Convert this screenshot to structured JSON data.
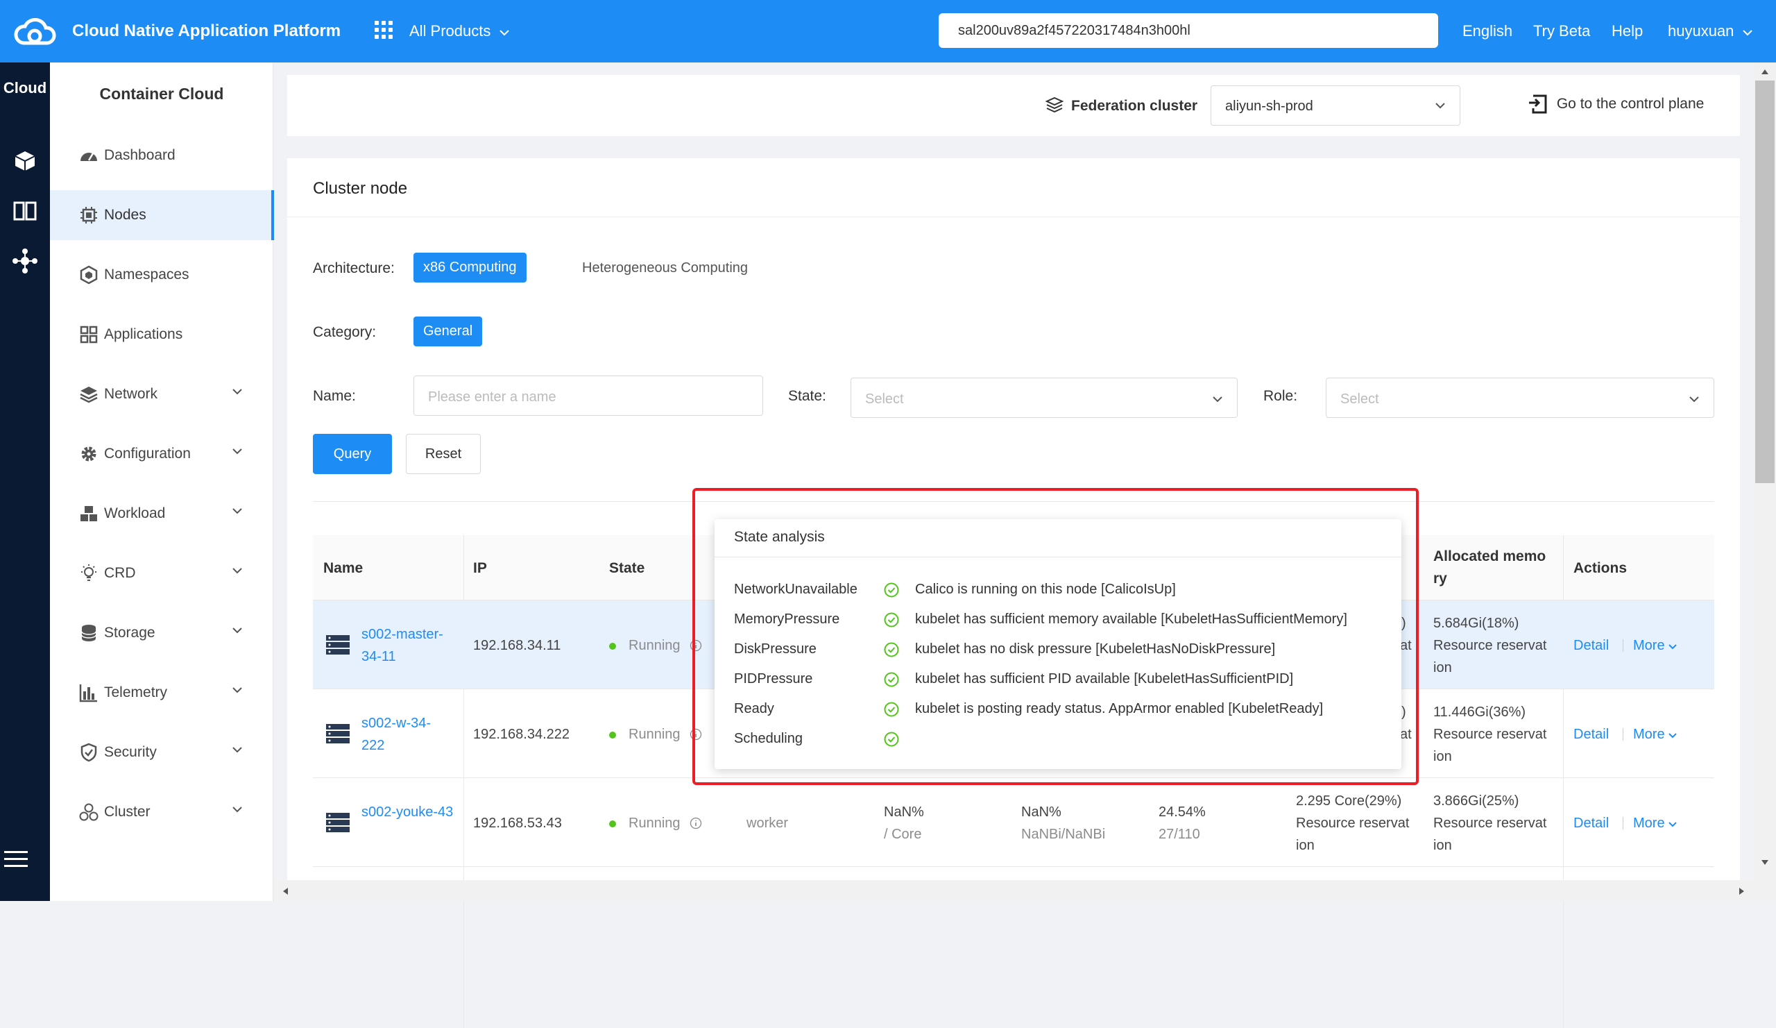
{
  "header": {
    "title": "Cloud Native Application Platform",
    "products_label": "All Products",
    "search_value": "sal200uv89a2f457220317484n3h00hl",
    "links": [
      "English",
      "Try Beta",
      "Help",
      "huyuxuan"
    ]
  },
  "rail": {
    "label": "Cloud"
  },
  "sidebar": {
    "heading": "Container Cloud",
    "items": [
      {
        "label": "Dashboard"
      },
      {
        "label": "Nodes"
      },
      {
        "label": "Namespaces"
      },
      {
        "label": "Applications"
      },
      {
        "label": "Network"
      },
      {
        "label": "Configuration"
      },
      {
        "label": "Workload"
      },
      {
        "label": "CRD"
      },
      {
        "label": "Storage"
      },
      {
        "label": "Telemetry"
      },
      {
        "label": "Security"
      },
      {
        "label": "Cluster"
      }
    ]
  },
  "fedbar": {
    "label": "Federation cluster",
    "selected": "aliyun-sh-prod",
    "control_plane": "Go to the control plane"
  },
  "page": {
    "title": "Cluster node",
    "architecture_label": "Architecture:",
    "architecture_options": [
      "x86 Computing",
      "Heterogeneous Computing"
    ],
    "category_label": "Category:",
    "category_options": [
      "General"
    ],
    "name_label": "Name:",
    "name_placeholder": "Please enter a name",
    "state_label": "State:",
    "state_placeholder": "Select",
    "role_label": "Role:",
    "role_placeholder": "Select",
    "query_label": "Query",
    "reset_label": "Reset"
  },
  "table": {
    "headers": [
      "Name",
      "IP",
      "State",
      "Allocated memo ry",
      "Actions"
    ],
    "rows": [
      {
        "name": "s002-master-34-11",
        "ip": "192.168.34.11",
        "state": "Running",
        "cpu_tail": ")",
        "cpu_tail2": "at",
        "mem": "5.684Gi(18%)",
        "mem_sub": "Resource reservat ion"
      },
      {
        "name": "s002-w-34-222",
        "ip": "192.168.34.222",
        "state": "Running",
        "cpu_tail": ")",
        "cpu_tail2": "at",
        "mem": "11.446Gi(36%)",
        "mem_sub": "Resource reservat ion"
      },
      {
        "name": "s002-youke-43",
        "ip": "192.168.53.43",
        "state": "Running",
        "role": "worker",
        "cpu_pct": "NaN%",
        "cpu_unit": "/ Core",
        "mem_pct": "NaN%",
        "mem_unit": "NaNBi/NaNBi",
        "pod_pct": "24.54%",
        "pods": "27/110",
        "alloc_cpu": "2.295 Core(29%)",
        "alloc_cpu_sub": "Resource reservat ion",
        "mem": "3.866Gi(25%)",
        "mem_sub": "Resource reservat ion"
      }
    ],
    "detail_label": "Detail",
    "more_label": "More"
  },
  "tooltip": {
    "title": "State analysis",
    "rows": [
      {
        "key": "NetworkUnavailable",
        "value": "Calico is running on this node [CalicoIsUp]"
      },
      {
        "key": "MemoryPressure",
        "value": "kubelet has sufficient memory available [KubeletHasSufficientMemory]"
      },
      {
        "key": "DiskPressure",
        "value": "kubelet has no disk pressure [KubeletHasNoDiskPressure]"
      },
      {
        "key": "PIDPressure",
        "value": "kubelet has sufficient PID available [KubeletHasSufficientPID]"
      },
      {
        "key": "Ready",
        "value": "kubelet is posting ready status. AppArmor enabled [KubeletReady]"
      },
      {
        "key": "Scheduling",
        "value": ""
      }
    ]
  }
}
